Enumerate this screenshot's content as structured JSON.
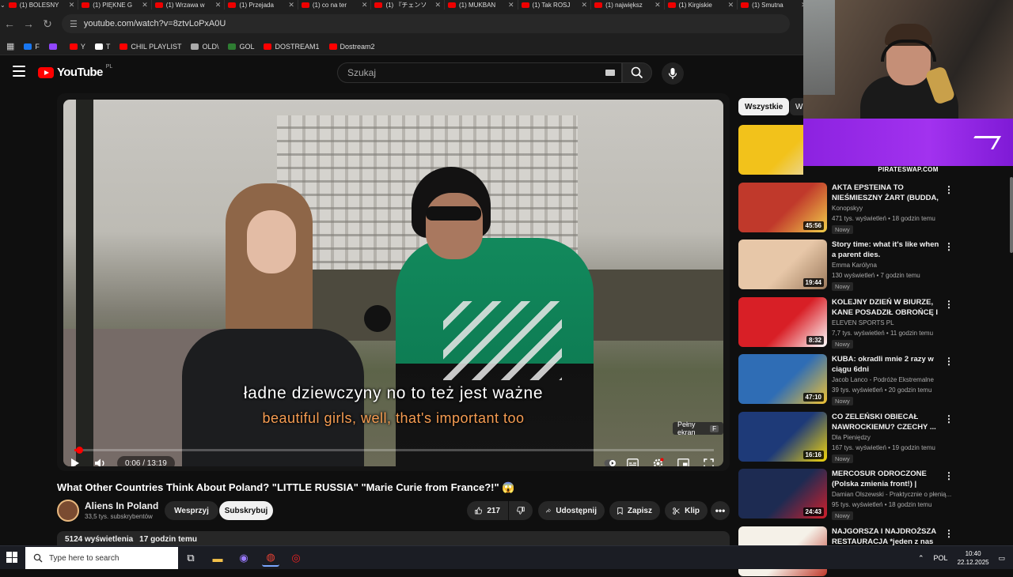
{
  "browser": {
    "tabs": [
      {
        "label": "(1) BOLESNY"
      },
      {
        "label": "(1) PIĘKNE G"
      },
      {
        "label": "(1) Wrzawa w"
      },
      {
        "label": "(1) Przejada"
      },
      {
        "label": "(1) co na ter"
      },
      {
        "label": "(1) 『チェンソー"
      },
      {
        "label": "(1) MUKBAN"
      },
      {
        "label": "(1) Tak ROSJ"
      },
      {
        "label": "(1) największ"
      },
      {
        "label": "(1) Kirgiskie"
      },
      {
        "label": "(1) Smutna"
      }
    ],
    "url": "youtube.com/watch?v=8ztvLoPxA0U",
    "bookmarks": [
      {
        "label": "F",
        "color": "#1877f2"
      },
      {
        "label": "",
        "color": "#9146ff"
      },
      {
        "label": "Y",
        "color": "#ff0000"
      },
      {
        "label": "T",
        "color": "#ffffff"
      },
      {
        "label": "CHIL PLAYLIST",
        "color": "#ff0000"
      },
      {
        "label": "OLD\\",
        "color": "#aaaaaa"
      },
      {
        "label": "GOL",
        "color": "#2e7d32"
      },
      {
        "label": "DOSTREAM1",
        "color": "#ff0000"
      },
      {
        "label": "Dostream2",
        "color": "#ff0000"
      }
    ]
  },
  "youtube": {
    "logo_text": "YouTube",
    "country_code": "PL",
    "search_placeholder": "Szukaj"
  },
  "player": {
    "subtitle_pl": "ładne dziewczyny no to też jest ważne",
    "subtitle_en": "beautiful girls, well, that's important too",
    "fullscreen_tip": "Pełny ekran",
    "fullscreen_key": "F",
    "time": "0:06 / 13:19",
    "progress_fraction": 0.0075
  },
  "video": {
    "title": "What Other Countries Think About Poland? \"LITTLE RUSSIA\" \"Marie Curie from France?!\" 😱",
    "channel": "Aliens In Poland",
    "subscribers": "33,5 tys. subskrybentów",
    "support_label": "Wesprzyj",
    "subscribe_label": "Subskrybuj",
    "likes": "217",
    "share_label": "Udostępnij",
    "save_label": "Zapisz",
    "clip_label": "Klip",
    "views": "5124 wyświetlenia",
    "age": "17 godzin temu"
  },
  "sidebar": {
    "chip_all": "Wszystkie",
    "chip_next": "W",
    "items": [
      {
        "title": "",
        "channel": "",
        "meta": "",
        "badge": "",
        "duration": "",
        "thumb_a": "#f2c21b",
        "thumb_b": "#e8e0c8"
      },
      {
        "title": "AKTA EPSTEINA TO NIEŚMIESZNY ŻART (BUDDA, ...",
        "channel": "Konopskyy",
        "meta": "471 tys. wyświetleń • 18 godzin temu",
        "badge": "Nowy",
        "duration": "45:56",
        "thumb_a": "#c0392b",
        "thumb_b": "#f2d04a"
      },
      {
        "title": "Story time: what it's like when a parent dies.",
        "channel": "Emma Karólyna",
        "meta": "130 wyświetleń • 7 godzin temu",
        "badge": "Nowy",
        "duration": "19:44",
        "thumb_a": "#e7c7a8",
        "thumb_b": "#9c7a5c"
      },
      {
        "title": "KOLEJNY DZIEŃ W BIURZE, KANE POSADZIŁ OBROŃCĘ I ...",
        "channel": "ELEVEN SPORTS PL",
        "meta": "7,7 tys. wyświetleń • 11 godzin temu",
        "badge": "Nowy",
        "duration": "8:32",
        "thumb_a": "#d81f26",
        "thumb_b": "#ffffff"
      },
      {
        "title": "KUBA: okradli mnie 2 razy w ciągu 6dni",
        "channel": "Jacob Lanco - Podróże Ekstremalne",
        "meta": "39 tys. wyświetleń • 20 godzin temu",
        "badge": "Nowy",
        "duration": "47:10",
        "thumb_a": "#2f6db5",
        "thumb_b": "#f1c232"
      },
      {
        "title": "CO ZELEŃSKI OBIECAŁ NAWROCKIEMU? CZECHY ...",
        "channel": "Dla Pieniędzy",
        "meta": "167 tys. wyświetleń • 19 godzin temu",
        "badge": "Nowy",
        "duration": "16:16",
        "thumb_a": "#1e3a78",
        "thumb_b": "#f2d60c"
      },
      {
        "title": "MERCOSUR ODROCZONE (Polska zmienia front!) | KONI...",
        "channel": "Damian Olszewski - Praktycznie o płenią...",
        "meta": "95 tys. wyświetleń • 18 godzin temu",
        "badge": "Nowy",
        "duration": "24:43",
        "thumb_a": "#1d2b52",
        "thumb_b": "#d11f2b"
      },
      {
        "title": "NAJGORSZA I NAJDROŻSZA RESTAURACJA *jeden z nas ni...",
        "channel": "",
        "meta": "",
        "badge": "",
        "duration": "",
        "thumb_a": "#f5f1e8",
        "thumb_b": "#c0392b"
      }
    ]
  },
  "overlay": {
    "banner_label": "PIRATESWAP.COM"
  },
  "taskbar": {
    "search_placeholder": "Type here to search",
    "language": "POL",
    "time": "10:40",
    "date": "22.12.2025"
  }
}
